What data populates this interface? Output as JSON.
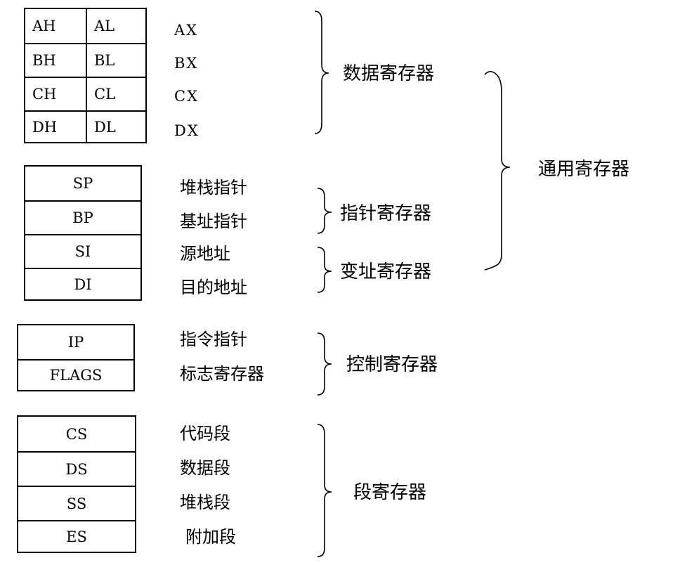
{
  "data_registers_table": {
    "rows": [
      {
        "high": "AH",
        "low": "AL"
      },
      {
        "high": "BH",
        "low": "BL"
      },
      {
        "high": "CH",
        "low": "CL"
      },
      {
        "high": "DH",
        "low": "DL"
      }
    ],
    "names": [
      "AX",
      "BX",
      "CX",
      "DX"
    ]
  },
  "pointer_index_table": {
    "rows": [
      "SP",
      "BP",
      "SI",
      "DI"
    ],
    "descriptions": [
      "堆栈指针",
      "基址指针",
      "源地址",
      "目的地址"
    ]
  },
  "control_table": {
    "rows": [
      "IP",
      "FLAGS"
    ],
    "descriptions": [
      "指令指针",
      "标志寄存器"
    ]
  },
  "segment_table": {
    "rows": [
      "CS",
      "DS",
      "SS",
      "ES"
    ],
    "descriptions": [
      "代码段",
      "数据段",
      "堆栈段",
      "附加段"
    ]
  },
  "groups": {
    "data_registers": "数据寄存器",
    "pointer_registers": "指针寄存器",
    "index_registers": "变址寄存器",
    "general_registers": "通用寄存器",
    "control_registers": "控制寄存器",
    "segment_registers": "段寄存器"
  }
}
